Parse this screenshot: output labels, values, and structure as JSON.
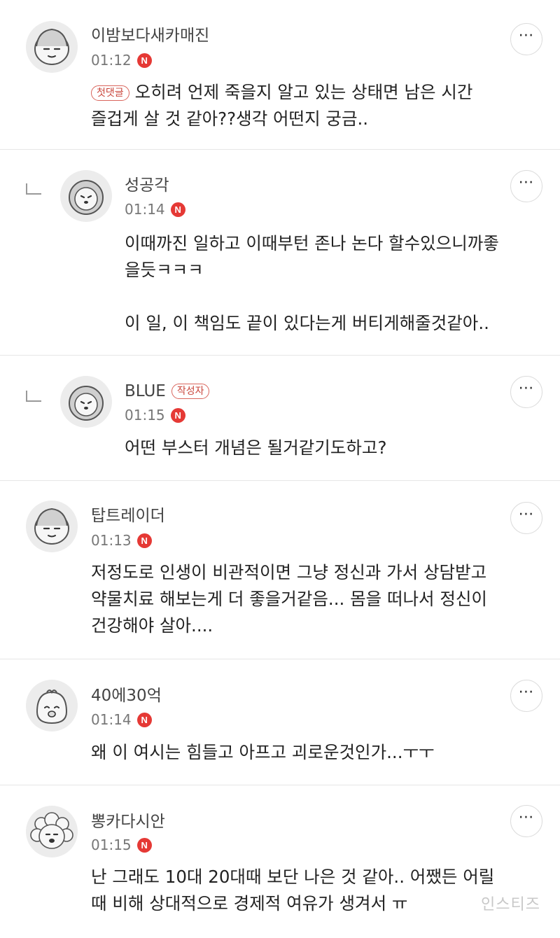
{
  "more_icon": "⋯",
  "new_badge": "N",
  "watermark": "인스티즈",
  "comments": [
    {
      "author": "이밤보다새카매진",
      "time": "01:12",
      "tag": "첫댓글",
      "lines": [
        "오히려 언제 죽을지 알고 있는 상태면 남은 시간",
        "즐겁게 살 것 같아??생각 어떤지 궁금.."
      ]
    },
    {
      "author": "성공각",
      "time": "01:14",
      "lines": [
        "이때까진 일하고 이때부턴 존나 논다 할수있으니까좋",
        "을듯ㅋㅋㅋ",
        "",
        "이 일, 이 책임도 끝이 있다는게 버티게해줄것같아.."
      ]
    },
    {
      "author": "BLUE",
      "author_tag": "작성자",
      "time": "01:15",
      "lines": [
        "어떤 부스터 개념은 될거같기도하고?"
      ]
    },
    {
      "author": "탑트레이더",
      "time": "01:13",
      "lines": [
        "저정도로 인생이 비관적이면 그냥 정신과 가서 상담받고",
        "약물치료 해보는게 더 좋을거같음... 몸을 떠나서 정신이",
        "건강해야 살아...."
      ]
    },
    {
      "author": "40에30억",
      "time": "01:14",
      "lines": [
        "왜 이 여시는 힘들고 아프고 괴로운것인가...ㅜㅜ"
      ]
    },
    {
      "author": "뽕카다시안",
      "time": "01:15",
      "lines": [
        "난 그래도 10대 20대때 보단 나은 것 같아.. 어쨌든 어릴",
        "때 비해 상대적으로 경제적 여유가 생겨서 ㅠ"
      ]
    }
  ]
}
